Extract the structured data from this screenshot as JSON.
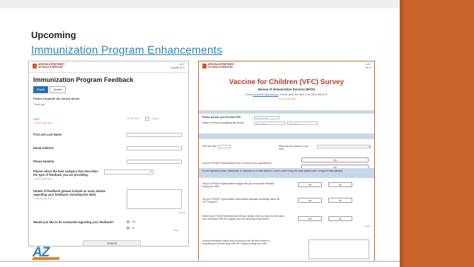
{
  "slide": {
    "heading": "Upcoming",
    "subtitle": "Immunization Program Enhancements",
    "logo": "AZ"
  },
  "header": {
    "dept_line1": "ARIZONA DEPARTMENT",
    "dept_line2": "OF HEALTH SERVICES",
    "translate": "English"
  },
  "feedback_form": {
    "title": "Immunization Program Feedback",
    "languages": [
      "English",
      "Spanish"
    ],
    "complete_prompt": "Please complete the survey below.",
    "thanks": "Thank you!",
    "required_note": "* must provide value",
    "fields": {
      "date": "Date",
      "date_value": "05-06-2016",
      "date_button": "Today",
      "first_last": "First and Last Name",
      "email": "Email Address",
      "phone": "Phone Number",
      "category": "Please select the best category that describes the type of feedback you are providing.",
      "details": "Details of feedback (please include as many details regarding your feedback, including the date)",
      "expand": "Expand",
      "contact": "Would you like to be contacted regarding your feedback?",
      "yes": "Yes",
      "no": "No",
      "reset": "reset"
    },
    "submit": "Submit"
  },
  "vfc_survey": {
    "title": "Vaccine for Children (VFC) Survey",
    "bureau": "Bureau of Immunization Services (BIOS)",
    "email_prefix": "Email: ",
    "email": "ArizonaVFC@azdhs.gov",
    "email_suffix": " | Phone: (602) 364-3642 | Fax: (602) 364-3276",
    "required_note": "* must provide value",
    "pin_label": "Please provide your Provider PIN:",
    "pin_placeholder": "VFC Number",
    "name_label": "Name of Person completing the survey:",
    "first_placeholder": "First Name",
    "last_placeholder": "Last Name",
    "site_visit": "Site Visit Date",
    "purpose": "What was the purpose of your visit?",
    "arrive_q": "Did your IPS/IQIP representative arrive on time for your appointment?",
    "satisfaction_note": "For the questions below: Satisfaction is measured on a scale between 1 and 5; with 5 being the most satisfied and 1 being the least satisfied.",
    "engage_q": "Did your IPS/IQIP representative engage with you and provide feedback during your visit?",
    "knowledge_q": "Did your IPS/IQIP representative demonstrate adequate knowledge about the VFC Program?",
    "inform_q": "Before your IPS/IQIP representative left your facility, were you fully informed about your compliance with the program and any necessary action items?",
    "other_q": "Is there information shared with you that you did not know before or something you learned about the VFC program during your visit?",
    "yes": "Yes",
    "no": "No",
    "reset": "reset"
  }
}
